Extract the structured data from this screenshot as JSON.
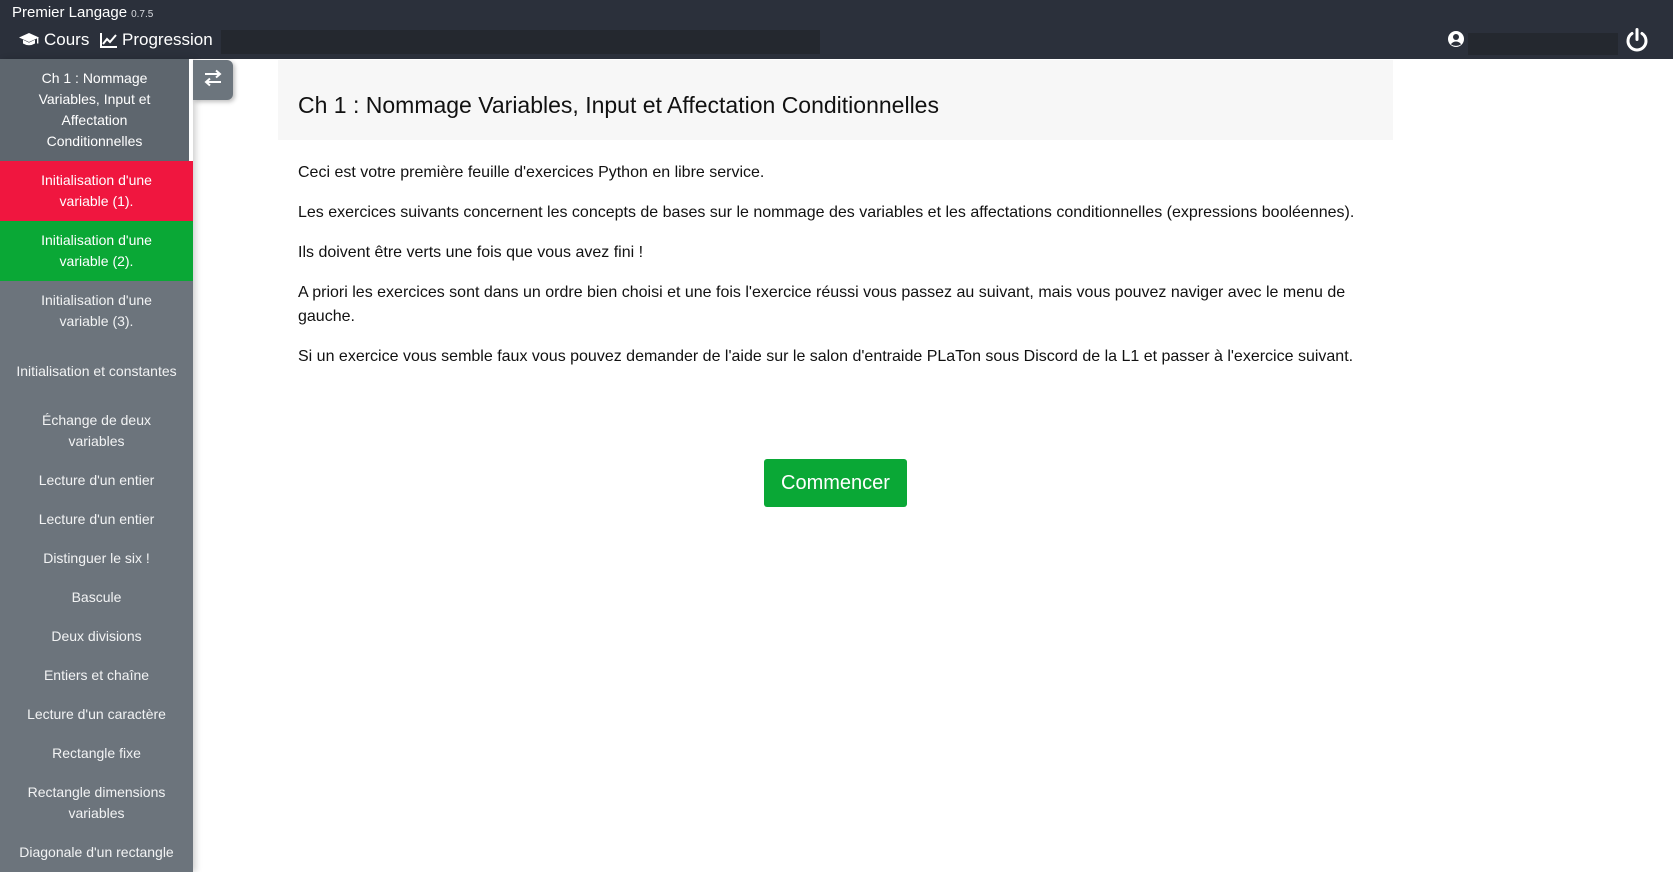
{
  "app": {
    "name": "Premier Langage",
    "version": "0.7.5"
  },
  "nav": {
    "cours": "Cours",
    "progression": "Progression"
  },
  "icons": {
    "cours": "graduation-cap-icon",
    "progression": "line-chart-icon",
    "user": "user-circle-icon",
    "power": "power-icon",
    "toggle": "swap-arrows-icon"
  },
  "colors": {
    "topbar": "#2b303b",
    "sidebar": "#6c747c",
    "failed": "#f0163f",
    "success": "#0aa836"
  },
  "sidebar": {
    "header": "Ch 1 : Nommage Variables, Input et Affectation Conditionnelles",
    "items": [
      {
        "label": "Initialisation d'une variable (1).",
        "status": "failed"
      },
      {
        "label": "Initialisation d'une variable (2).",
        "status": "success"
      },
      {
        "label": "Initialisation d'une variable (3).",
        "status": "none"
      },
      {
        "label": "Initialisation et constantes",
        "status": "none"
      },
      {
        "label": "Échange de deux variables",
        "status": "none"
      },
      {
        "label": "Lecture d'un entier",
        "status": "none"
      },
      {
        "label": "Lecture d'un entier",
        "status": "none"
      },
      {
        "label": "Distinguer le six !",
        "status": "none"
      },
      {
        "label": "Bascule",
        "status": "none"
      },
      {
        "label": "Deux divisions",
        "status": "none"
      },
      {
        "label": "Entiers et chaîne",
        "status": "none"
      },
      {
        "label": "Lecture d'un caractère",
        "status": "none"
      },
      {
        "label": "Rectangle fixe",
        "status": "none"
      },
      {
        "label": "Rectangle dimensions variables",
        "status": "none"
      },
      {
        "label": "Diagonale d'un rectangle",
        "status": "none"
      }
    ]
  },
  "main": {
    "title": "Ch 1 : Nommage Variables, Input et Affectation Conditionnelles",
    "paragraphs": [
      "Ceci est votre première feuille d'exercices Python en libre service.",
      "Les exercices suivants concernent les concepts de bases sur le nommage des variables et les affectations conditionnelles (expressions booléennes).",
      "Ils doivent être verts une fois que vous avez fini !",
      "A priori les exercices sont dans un ordre bien choisi et une fois l'exercice réussi vous passez au suivant, mais vous pouvez naviger avec le menu de gauche.",
      "Si un exercice vous semble faux vous pouvez demander de l'aide sur le salon d'entraide PLaTon sous Discord de la L1 et passer à l'exercice suivant."
    ],
    "start_label": "Commencer"
  }
}
